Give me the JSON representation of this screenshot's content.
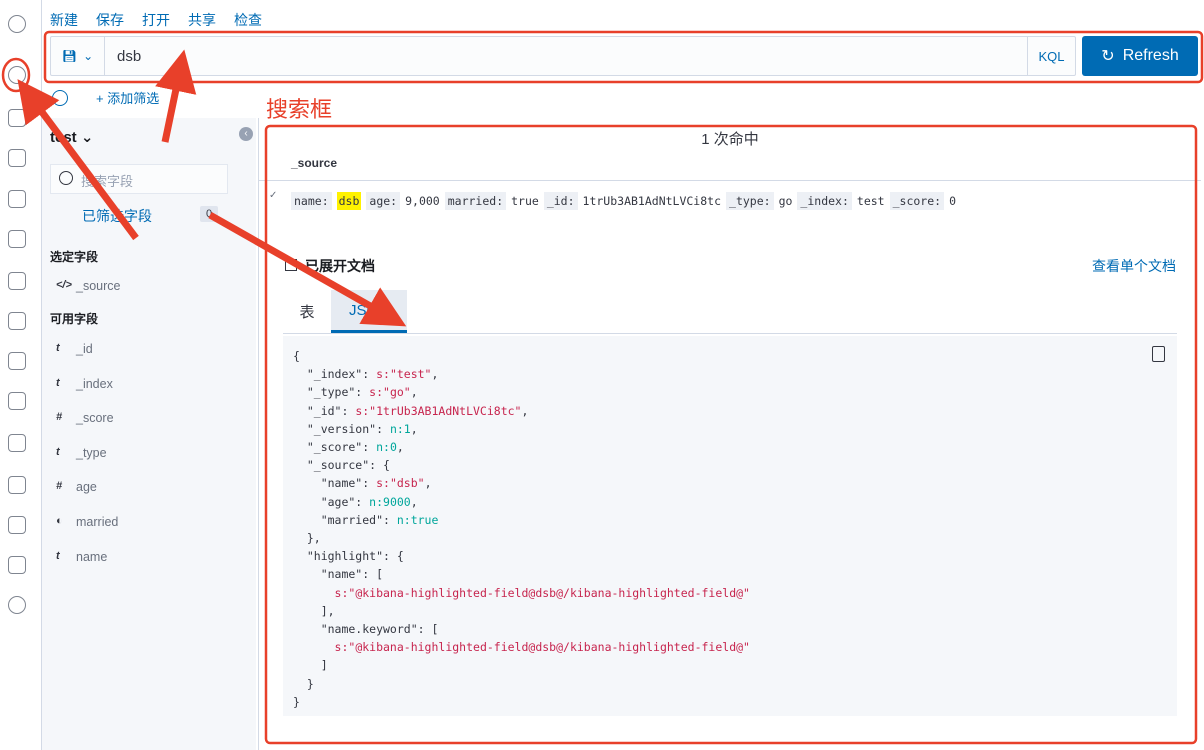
{
  "top_menu": [
    "新建",
    "保存",
    "打开",
    "共享",
    "检查"
  ],
  "query": {
    "value": "dsb",
    "language": "KQL",
    "refresh_label": "Refresh"
  },
  "filter": {
    "add_label": "+ 添加筛选"
  },
  "sidebar": {
    "index_pattern": "test",
    "search_placeholder": "搜索字段",
    "filtered_label": "已筛选字段",
    "filtered_count": "0",
    "selected_header": "选定字段",
    "selected_fields": [
      {
        "type": "</>",
        "name": "_source"
      }
    ],
    "available_header": "可用字段",
    "available_fields": [
      {
        "type": "t",
        "name": "_id"
      },
      {
        "type": "t",
        "name": "_index"
      },
      {
        "type": "#",
        "name": "_score"
      },
      {
        "type": "t",
        "name": "_type"
      },
      {
        "type": "#",
        "name": "age"
      },
      {
        "type": "◐",
        "name": "married"
      },
      {
        "type": "t",
        "name": "name"
      }
    ]
  },
  "main": {
    "hits": "1 次命中",
    "column": "_source",
    "doc_row": [
      {
        "k": "name:",
        "v": "dsb",
        "hl": true
      },
      {
        "k": "age:",
        "v": "9,000"
      },
      {
        "k": "married:",
        "v": "true"
      },
      {
        "k": "_id:",
        "v": "1trUb3AB1AdNtLVCi8tc"
      },
      {
        "k": "_type:",
        "v": "go"
      },
      {
        "k": "_index:",
        "v": "test"
      },
      {
        "k": "_score:",
        "v": "0"
      }
    ],
    "expanded_label": "已展开文档",
    "view_single": "查看单个文档",
    "tabs": [
      "表",
      "JSON"
    ],
    "json_lines": [
      [
        "{"
      ],
      [
        "  \"_index\": ",
        "s:\"test\"",
        ","
      ],
      [
        "  \"_type\": ",
        "s:\"go\"",
        ","
      ],
      [
        "  \"_id\": ",
        "s:\"1trUb3AB1AdNtLVCi8tc\"",
        ","
      ],
      [
        "  \"_version\": ",
        "n:1",
        ","
      ],
      [
        "  \"_score\": ",
        "n:0",
        ","
      ],
      [
        "  \"_source\": {"
      ],
      [
        "    \"name\": ",
        "s:\"dsb\"",
        ","
      ],
      [
        "    \"age\": ",
        "n:9000",
        ","
      ],
      [
        "    \"married\": ",
        "n:true"
      ],
      [
        "  },"
      ],
      [
        "  \"highlight\": {"
      ],
      [
        "    \"name\": ["
      ],
      [
        "      ",
        "s:\"@kibana-highlighted-field@dsb@/kibana-highlighted-field@\""
      ],
      [
        "    ],"
      ],
      [
        "    \"name.keyword\": ["
      ],
      [
        "      ",
        "s:\"@kibana-highlighted-field@dsb@/kibana-highlighted-field@\""
      ],
      [
        "    ]"
      ],
      [
        "  }"
      ],
      [
        "}"
      ]
    ]
  },
  "annotation": {
    "label": "搜索框",
    "color": "#e8402a"
  },
  "colors": {
    "accent": "#006bb4",
    "highlight": "#fff200",
    "annotation": "#e8402a"
  }
}
